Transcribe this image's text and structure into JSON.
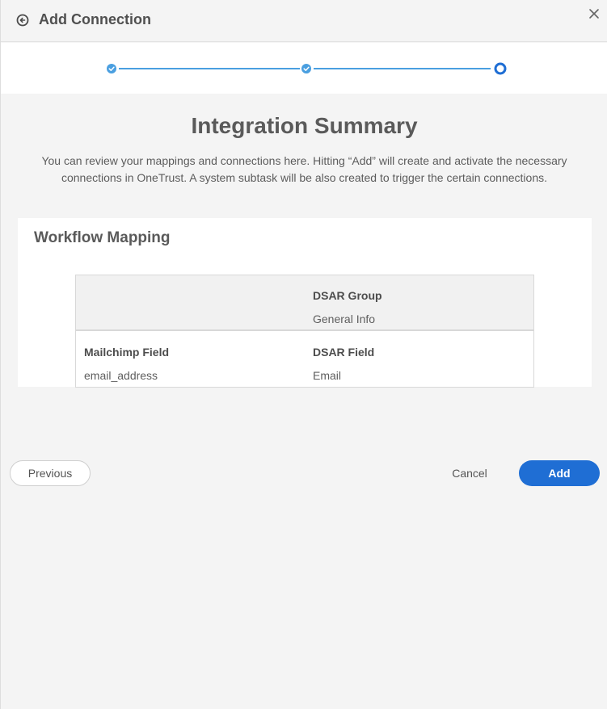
{
  "header": {
    "title": "Add Connection",
    "back_icon": "back-arrow-circle-icon",
    "close_icon": "close-icon"
  },
  "stepper": {
    "steps": [
      {
        "state": "complete",
        "icon": "check-icon"
      },
      {
        "state": "complete",
        "icon": "check-icon"
      },
      {
        "state": "current",
        "icon": "ring-icon"
      }
    ],
    "accent_color": "#4a9fe0"
  },
  "summary": {
    "title": "Integration Summary",
    "description": "You can review your mappings and connections here. Hitting “Add” will create and activate the necessary connections in OneTrust. A system subtask will be also created to trigger the certain connections."
  },
  "workflow_mapping": {
    "title": "Workflow Mapping",
    "group_header_label": "DSAR Group",
    "group_header_value": "General Info",
    "columns": {
      "source_label": "Mailchimp Field",
      "target_label": "DSAR Field"
    },
    "rows": [
      {
        "source": "email_address",
        "target": "Email"
      }
    ]
  },
  "footer": {
    "previous_label": "Previous",
    "cancel_label": "Cancel",
    "add_label": "Add",
    "primary_color": "#1f6ed4"
  }
}
